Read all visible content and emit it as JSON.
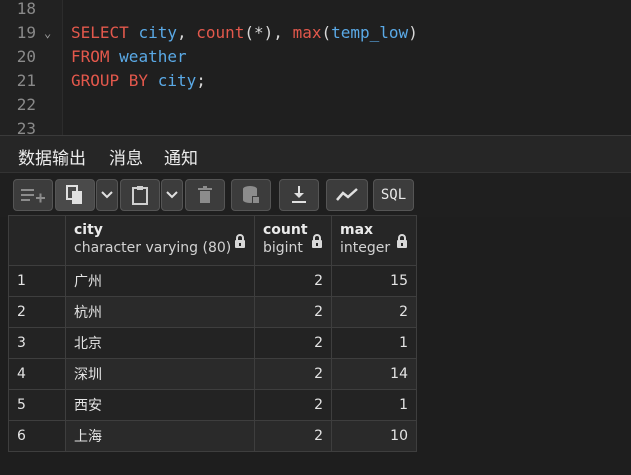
{
  "editor": {
    "lines": [
      {
        "num": "18",
        "tokens": []
      },
      {
        "num": "19",
        "fold": "⌄",
        "tokens": [
          {
            "t": "SELECT",
            "c": "kw"
          },
          {
            "t": " ",
            "c": "pn"
          },
          {
            "t": "city",
            "c": "id"
          },
          {
            "t": ", ",
            "c": "pn"
          },
          {
            "t": "count",
            "c": "kw"
          },
          {
            "t": "(*), ",
            "c": "pn"
          },
          {
            "t": "max",
            "c": "kw"
          },
          {
            "t": "(",
            "c": "pn"
          },
          {
            "t": "temp_low",
            "c": "id"
          },
          {
            "t": ")",
            "c": "pn"
          }
        ]
      },
      {
        "num": "20",
        "tokens": [
          {
            "t": "FROM",
            "c": "kw"
          },
          {
            "t": " ",
            "c": "pn"
          },
          {
            "t": "weather",
            "c": "id"
          }
        ]
      },
      {
        "num": "21",
        "tokens": [
          {
            "t": "GROUP BY",
            "c": "kw"
          },
          {
            "t": " ",
            "c": "pn"
          },
          {
            "t": "city",
            "c": "id"
          },
          {
            "t": ";",
            "c": "pn"
          }
        ]
      },
      {
        "num": "22",
        "tokens": []
      },
      {
        "num": "23",
        "tokens": []
      }
    ]
  },
  "tabs": [
    {
      "label": "数据输出",
      "active": true
    },
    {
      "label": "消息",
      "active": false
    },
    {
      "label": "通知",
      "active": false
    }
  ],
  "toolbar": {
    "sql_label": "SQL",
    "icons": [
      "add-row-icon",
      "copy-icon",
      "chevron-down-icon",
      "paste-icon",
      "chevron-down-icon",
      "delete-icon",
      "save-data-icon",
      "download-icon",
      "graph-icon",
      "sql-icon"
    ]
  },
  "table": {
    "columns": [
      {
        "name": "city",
        "type": "character varying (80)"
      },
      {
        "name": "count",
        "type": "bigint"
      },
      {
        "name": "max",
        "type": "integer"
      }
    ],
    "rows": [
      {
        "n": "1",
        "city": "广州",
        "count": "2",
        "max": "15"
      },
      {
        "n": "2",
        "city": "杭州",
        "count": "2",
        "max": "2"
      },
      {
        "n": "3",
        "city": "北京",
        "count": "2",
        "max": "1"
      },
      {
        "n": "4",
        "city": "深圳",
        "count": "2",
        "max": "14"
      },
      {
        "n": "5",
        "city": "西安",
        "count": "2",
        "max": "1"
      },
      {
        "n": "6",
        "city": "上海",
        "count": "2",
        "max": "10"
      }
    ]
  }
}
